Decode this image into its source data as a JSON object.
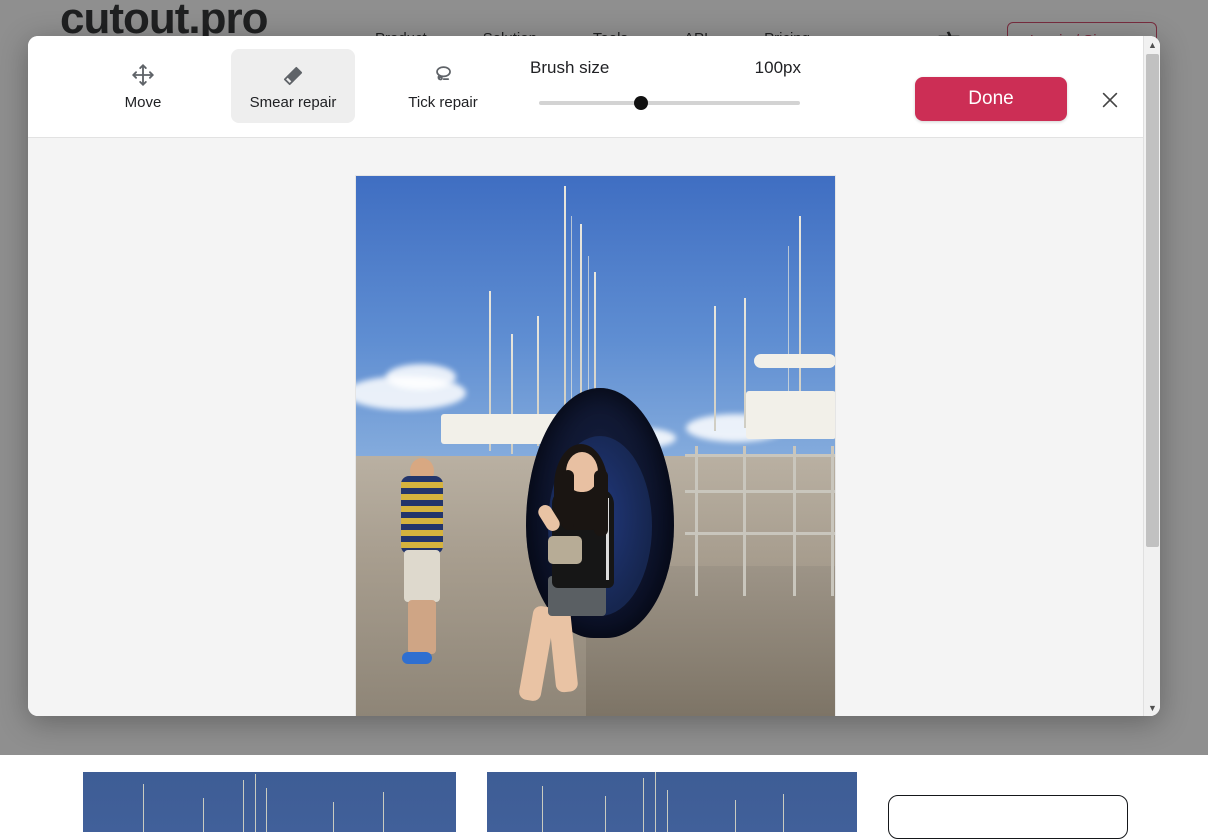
{
  "background": {
    "logo": "cutout.pro",
    "nav": [
      {
        "label": "Product"
      },
      {
        "label": "Solution"
      },
      {
        "label": "Tools"
      },
      {
        "label": "API"
      },
      {
        "label": "Pricing"
      }
    ],
    "language_icon": "translate-icon",
    "login_label": "Log in / Sign up"
  },
  "editor": {
    "tools": [
      {
        "id": "move",
        "label": "Move",
        "icon": "move-arrows-icon",
        "selected": false
      },
      {
        "id": "smear",
        "label": "Smear repair",
        "icon": "eraser-icon",
        "selected": true
      },
      {
        "id": "tick",
        "label": "Tick repair",
        "icon": "lasso-loop-icon",
        "selected": false
      }
    ],
    "brush": {
      "label": "Brush size",
      "value_text": "100px",
      "value": 100,
      "min": 1,
      "max": 260,
      "percent": 39
    },
    "done_label": "Done",
    "close_icon": "close-icon",
    "canvas": {
      "image_alt": "Woman seated in blue pod sculpture at a marina dock with sailboat masts",
      "background_color": "#f4f4f4"
    },
    "scrollbar": {
      "up_icon": "chevron-up-icon",
      "down_icon": "chevron-down-icon"
    }
  },
  "colors": {
    "accent": "#cc2e55",
    "selected_tool_bg": "#eeeeee",
    "canvas_bg": "#f4f4f4",
    "overlay": "rgba(40,40,40,0.52)",
    "slider_thumb": "#111111",
    "slider_track": "#d3d3d3"
  }
}
